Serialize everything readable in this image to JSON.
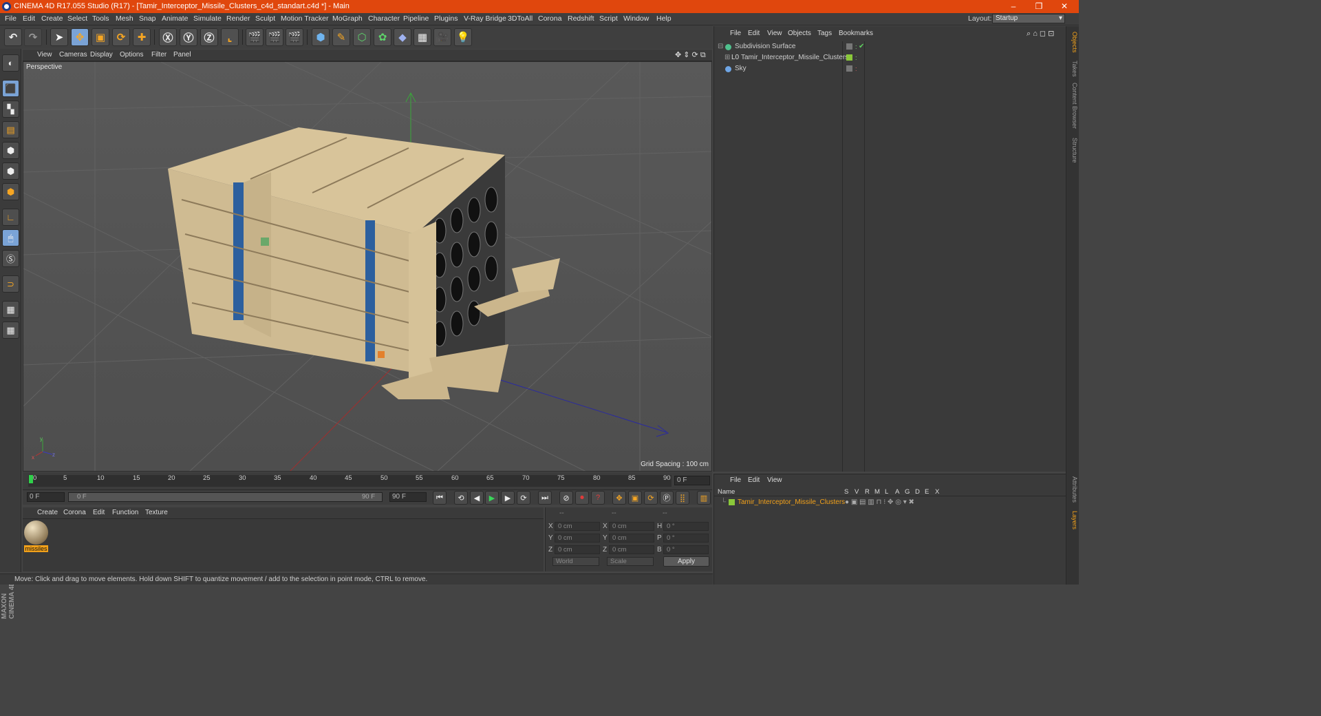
{
  "titlebar": {
    "title": "CINEMA 4D R17.055 Studio (R17) - [Tamir_Interceptor_Missile_Clusters_c4d_standart.c4d *] - Main",
    "min": "–",
    "max": "❐",
    "close": "✕"
  },
  "menubar": {
    "items": [
      "File",
      "Edit",
      "Create",
      "Select",
      "Tools",
      "Mesh",
      "Snap",
      "Animate",
      "Simulate",
      "Render",
      "Sculpt",
      "Motion Tracker",
      "MoGraph",
      "Character",
      "Pipeline",
      "Plugins",
      "V-Ray Bridge",
      "3DToAll",
      "Corona",
      "Redshift",
      "Script",
      "Window",
      "Help"
    ],
    "layout_label": "Layout:",
    "layout_value": "Startup"
  },
  "viewport": {
    "menu": [
      "View",
      "Cameras",
      "Display",
      "Options",
      "Filter",
      "Panel"
    ],
    "label": "Perspective",
    "grid_spacing": "Grid Spacing : 100 cm",
    "axis_y": "y",
    "axis_x": "x",
    "axis_z": "z"
  },
  "timeline": {
    "ticks": [
      "0",
      "5",
      "10",
      "15",
      "20",
      "25",
      "30",
      "35",
      "40",
      "45",
      "50",
      "55",
      "60",
      "65",
      "70",
      "75",
      "80",
      "85",
      "90"
    ],
    "frame_field": "0 F",
    "start_field": "0 F",
    "range_start": "0 F",
    "range_end": "90 F",
    "end_field": "90 F"
  },
  "materials": {
    "menu": [
      "Create",
      "Corona",
      "Edit",
      "Function",
      "Texture"
    ],
    "items": [
      {
        "name": "missiles"
      }
    ]
  },
  "coords": {
    "header": [
      "--",
      "--",
      "--"
    ],
    "rows": [
      {
        "a": "X",
        "av": "0 cm",
        "b": "X",
        "bv": "0 cm",
        "c": "H",
        "cv": "0 °"
      },
      {
        "a": "Y",
        "av": "0 cm",
        "b": "Y",
        "bv": "0 cm",
        "c": "P",
        "cv": "0 °"
      },
      {
        "a": "Z",
        "av": "0 cm",
        "b": "Z",
        "bv": "0 cm",
        "c": "B",
        "cv": "0 °"
      }
    ],
    "world": "World",
    "scale": "Scale",
    "apply": "Apply"
  },
  "statusbar": {
    "text": "Move: Click and drag to move elements. Hold down SHIFT to quantize movement / add to the selection in point mode, CTRL to remove."
  },
  "objects": {
    "menu": [
      "File",
      "Edit",
      "View",
      "Objects",
      "Tags",
      "Bookmarks"
    ],
    "items": [
      {
        "name": "Subdivision Surface"
      },
      {
        "name": "Tamir_Interceptor_Missile_Clusters"
      },
      {
        "name": "Sky"
      }
    ]
  },
  "attributes": {
    "menu": [
      "File",
      "Edit",
      "View"
    ],
    "col_name": "Name",
    "cols": [
      "S",
      "V",
      "R",
      "M",
      "L",
      "A",
      "G",
      "D",
      "E",
      "X"
    ],
    "row": "Tamir_Interceptor_Missile_Clusters"
  },
  "right_tabs": [
    "Objects",
    "Takes",
    "Content Browser",
    "Structure"
  ],
  "right_tabs_bottom": [
    "Attributes",
    "Layers"
  ],
  "colors": {
    "accent": "#e0470d",
    "selected_tool": "#7aa3d6",
    "layer_green": "#8ac83a"
  }
}
